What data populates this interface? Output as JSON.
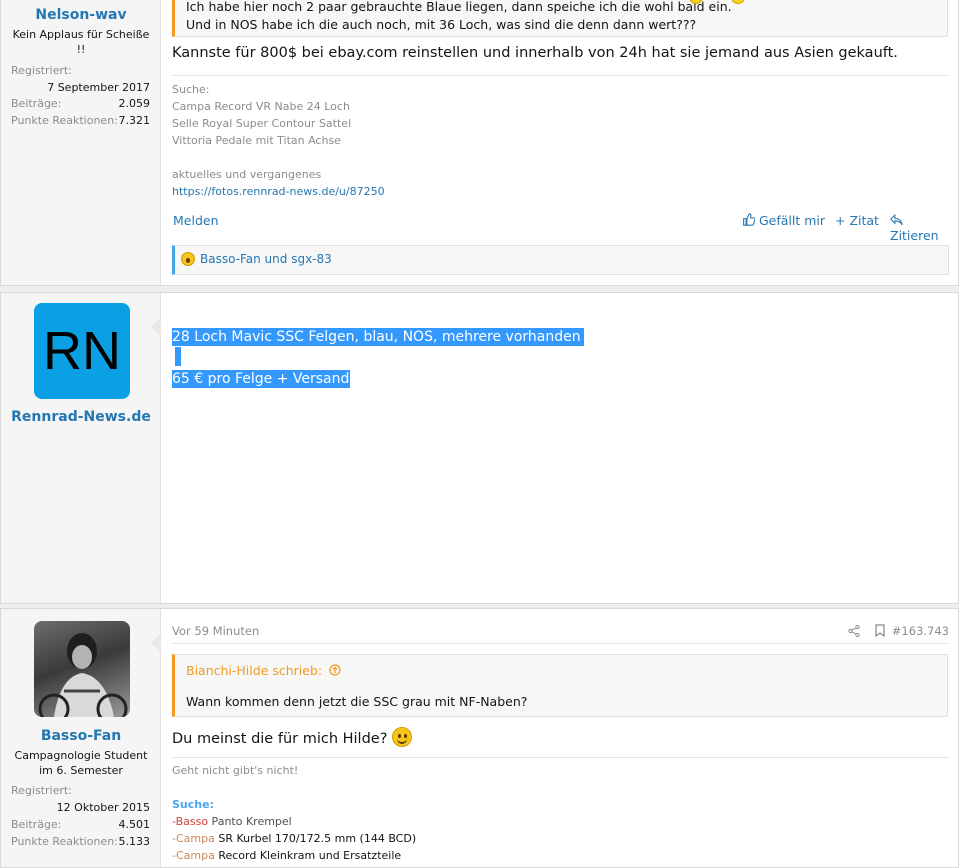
{
  "post1": {
    "username": "Nelson-wav",
    "user_title": "Kein Applaus für Scheiße !!",
    "stats": [
      {
        "label": "Registriert:",
        "value": "7 September 2017"
      },
      {
        "label": "Beiträge:",
        "value": "2.059"
      },
      {
        "label": "Punkte Reaktionen:",
        "value": "7.321"
      }
    ],
    "quote_lines": [
      "Ich habe hier noch 2 paar gebrauchte Blaue liegen, dann speiche ich die wohl bald ein.",
      "Und in NOS habe ich die auch noch, mit 36 Loch, was sind die denn dann wert???"
    ],
    "body": "Kannste für 800$ bei ebay.com reinstellen und innerhalb von 24h hat sie jemand aus Asien gekauft.",
    "signature": {
      "lines": [
        "Suche:",
        "Campa Record VR Nabe 24 Loch",
        "Selle Royal Super Contour Sattel",
        "Vittoria Pedale mit Titan Achse",
        "",
        "aktuelles und vergangenes"
      ],
      "link": "https://fotos.rennrad-news.de/u/87250"
    },
    "report": "Melden",
    "like": "Gefällt mir",
    "zitat": "+ Zitat",
    "zitieren": "Zitieren",
    "reactions": "Basso-Fan und sgx-83"
  },
  "post2": {
    "avatar_text": "RN",
    "username": "Rennrad-News.de",
    "line1": "28 Loch Mavic SSC Felgen, blau, NOS, mehrere vorhanden",
    "line2": "65 € pro Felge + Versand"
  },
  "post3": {
    "username": "Basso-Fan",
    "user_title": "Campagnologie Student im 6. Semester",
    "stats": [
      {
        "label": "Registriert:",
        "value": "12 Oktober 2015"
      },
      {
        "label": "Beiträge:",
        "value": "4.501"
      },
      {
        "label": "Punkte Reaktionen:",
        "value": "5.133"
      }
    ],
    "time": "Vor 59 Minuten",
    "post_number": "#163.743",
    "quote_author": "Bianchi-Hilde schrieb:",
    "quote_text": "Wann kommen denn jetzt die SSC grau mit NF-Naben?",
    "body": "Du meinst die für mich Hilde?",
    "sig_line1": "Geht nicht gibt's nicht!",
    "sig_heading": "Suche:",
    "sig_items": [
      {
        "brand": "-Basso",
        "text": " Panto Krempel",
        "color": "#d43f3a"
      },
      {
        "brand": "-Campa",
        "text": " SR Kurbel 170/172.5 mm (144 BCD)",
        "color": "#c9885d"
      },
      {
        "brand": "-Campa",
        "text": " Record Kleinkram und Ersatzteile",
        "color": "#c9885d"
      }
    ]
  },
  "colors": {
    "accent": "#2577b1",
    "quote_bar": "#f39a1f",
    "selection": "#3399ff",
    "rn_avatar": "#0ba0e3"
  }
}
